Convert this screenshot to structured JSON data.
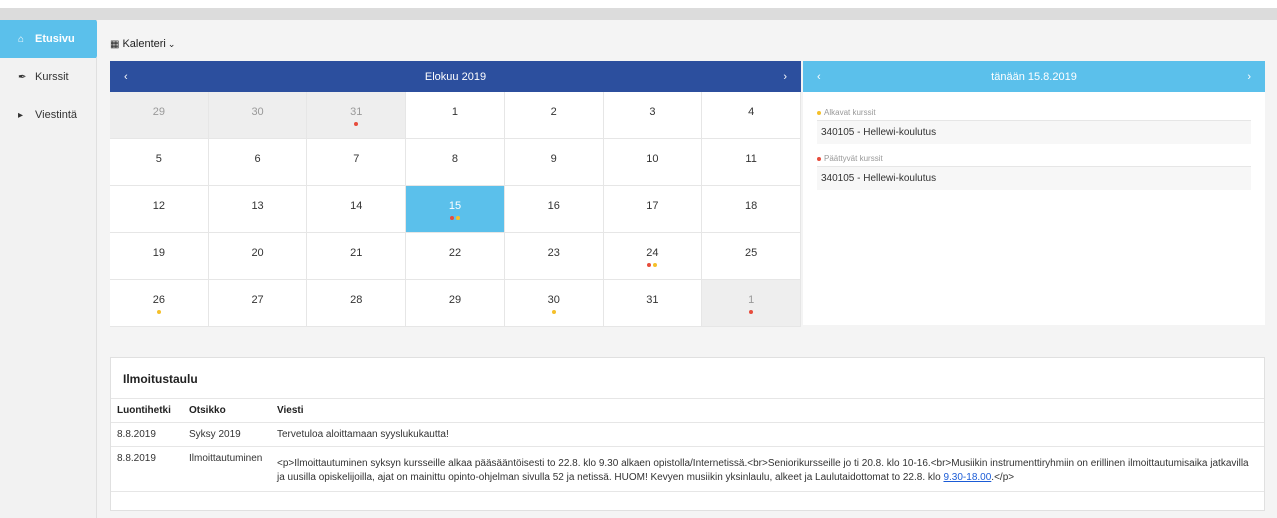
{
  "sidebar": {
    "items": [
      {
        "label": "Etusivu",
        "icon": "home-icon",
        "active": true
      },
      {
        "label": "Kurssit",
        "icon": "brush-icon",
        "active": false
      },
      {
        "label": "Viestintä",
        "icon": "bullhorn-icon",
        "active": false
      }
    ]
  },
  "calendar_menu": {
    "label": "Kalenteri",
    "icon": "calendar-icon"
  },
  "calendar": {
    "title": "Elokuu 2019",
    "prev": "‹",
    "next": "›",
    "days": [
      {
        "n": "29",
        "other": true,
        "dots": []
      },
      {
        "n": "30",
        "other": true,
        "dots": []
      },
      {
        "n": "31",
        "other": true,
        "dots": [
          "#e74c3c"
        ]
      },
      {
        "n": "1",
        "dots": []
      },
      {
        "n": "2",
        "dots": []
      },
      {
        "n": "3",
        "dots": []
      },
      {
        "n": "4",
        "dots": []
      },
      {
        "n": "5",
        "dots": []
      },
      {
        "n": "6",
        "dots": []
      },
      {
        "n": "7",
        "dots": []
      },
      {
        "n": "8",
        "dots": []
      },
      {
        "n": "9",
        "dots": []
      },
      {
        "n": "10",
        "dots": []
      },
      {
        "n": "11",
        "dots": []
      },
      {
        "n": "12",
        "dots": []
      },
      {
        "n": "13",
        "dots": []
      },
      {
        "n": "14",
        "dots": []
      },
      {
        "n": "15",
        "today": true,
        "dots": [
          "#e74c3c",
          "#f5c02a"
        ]
      },
      {
        "n": "16",
        "dots": []
      },
      {
        "n": "17",
        "dots": []
      },
      {
        "n": "18",
        "dots": []
      },
      {
        "n": "19",
        "dots": []
      },
      {
        "n": "20",
        "dots": []
      },
      {
        "n": "21",
        "dots": []
      },
      {
        "n": "22",
        "dots": []
      },
      {
        "n": "23",
        "dots": []
      },
      {
        "n": "24",
        "dots": [
          "#e74c3c",
          "#f5c02a"
        ]
      },
      {
        "n": "25",
        "dots": []
      },
      {
        "n": "26",
        "dots": [
          "#f5c02a"
        ]
      },
      {
        "n": "27",
        "dots": []
      },
      {
        "n": "28",
        "dots": []
      },
      {
        "n": "29",
        "dots": []
      },
      {
        "n": "30",
        "dots": [
          "#f5c02a"
        ]
      },
      {
        "n": "31",
        "dots": []
      },
      {
        "n": "1",
        "other": true,
        "dots": [
          "#e74c3c"
        ]
      }
    ]
  },
  "day_panel": {
    "title": "tänään 15.8.2019",
    "prev": "‹",
    "next": "›",
    "starting_label": "Alkavat kurssit",
    "starting_color": "#f5c02a",
    "starting_item": "340105 - Hellewi-koulutus",
    "ending_label": "Päättyvät kurssit",
    "ending_color": "#e74c3c",
    "ending_item": "340105 - Hellewi-koulutus"
  },
  "board": {
    "title": "Ilmoitustaulu",
    "headers": [
      "Luontihetki",
      "Otsikko",
      "Viesti"
    ],
    "rows": [
      {
        "date": "8.8.2019",
        "title": "Syksy 2019",
        "msg": "Tervetuloa aloittamaan syyslukukautta!"
      },
      {
        "date": "8.8.2019",
        "title": "Ilmoittautuminen",
        "msg": "<p>Ilmoittautuminen syksyn kursseille alkaa pääsääntöisesti to 22.8. klo 9.30 alkaen opistolla/Internetissä.<br>Seniorikursseille jo ti 20.8. klo 10-16.<br>Musiikin instrumenttiryhmiin on erillinen ilmoittautumisaika jatkavilla ja uusilla opiskelijoilla, ajat on mainittu opinto-ohjelman sivulla 52 ja netissä. HUOM! Kevyen musiikin yksinlaulu, alkeet ja Laulutaidottomat to 22.8. klo ",
        "link": "9.30-18.00",
        "msg_end": ".</p>"
      }
    ]
  },
  "colors": {
    "accent": "#5bc0eb",
    "header": "#2c4f9e",
    "red": "#e74c3c",
    "yellow": "#f5c02a"
  }
}
